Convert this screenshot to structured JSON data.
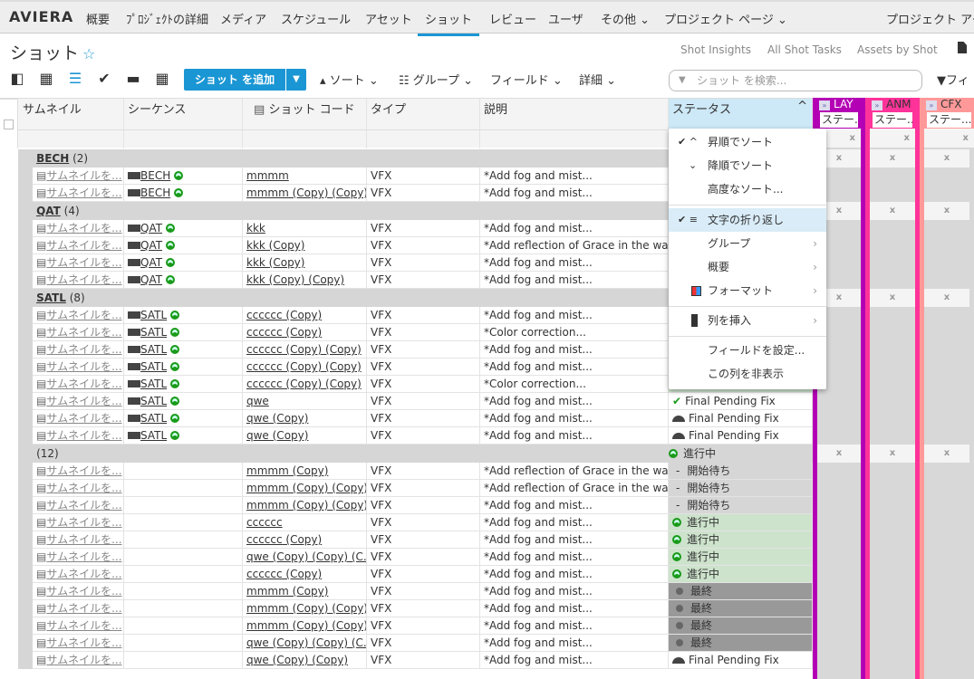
{
  "nav": {
    "logo": "AVIERA",
    "items": [
      "概要",
      "ﾌﾟﾛｼﾞｪｸﾄの詳細",
      "メディア",
      "スケジュール",
      "アセット",
      "ショット",
      "レビュー",
      "ユーザ",
      "その他 ⌄",
      "プロジェクト ページ ⌄"
    ],
    "active": "ショット",
    "right": "プロジェクト アク"
  },
  "page": {
    "title": "ショット",
    "links": [
      "Shot Insights",
      "All Shot Tasks",
      "Assets by Shot"
    ]
  },
  "toolbar": {
    "add": "ショット を追加",
    "sort": "ソート",
    "group": "グループ",
    "fields": "フィールド",
    "detail": "詳細",
    "search_placeholder": "ショット を検索...",
    "filter": "フィ"
  },
  "columns": [
    "サムネイル",
    "シーケンス",
    "ショット コード",
    "タイプ",
    "説明",
    "ステータス"
  ],
  "tasks": [
    {
      "name": "LAY",
      "color": "#b400b4",
      "text": "#fff"
    },
    {
      "name": "ANM",
      "color": "#ff3399",
      "text": "#333"
    },
    {
      "name": "CFX",
      "color": "#ff9999",
      "text": "#333"
    }
  ],
  "task_sub": "ステー...",
  "thumb_text": "サムネイルを...",
  "groups": [
    {
      "name": "BECH",
      "count": "(2)",
      "rows": [
        {
          "seq": "BECH",
          "code": "mmmm",
          "type": "VFX",
          "desc": "*Add fog and mist...",
          "status": ""
        },
        {
          "seq": "BECH",
          "code": "mmmm (Copy) (Copy)",
          "type": "VFX",
          "desc": "*Add fog and mist...",
          "status": ""
        }
      ]
    },
    {
      "name": "QAT",
      "count": "(4)",
      "rows": [
        {
          "seq": "QAT",
          "code": "kkk",
          "type": "VFX",
          "desc": "*Add fog and mist...",
          "status": ""
        },
        {
          "seq": "QAT",
          "code": "kkk (Copy)",
          "type": "VFX",
          "desc": "*Add reflection of Grace in the wat...",
          "status": ""
        },
        {
          "seq": "QAT",
          "code": "kkk (Copy)",
          "type": "VFX",
          "desc": "*Add fog and mist...",
          "status": ""
        },
        {
          "seq": "QAT",
          "code": "kkk (Copy) (Copy)",
          "type": "VFX",
          "desc": "*Add fog and mist...",
          "status": ""
        }
      ]
    },
    {
      "name": "SATL",
      "count": "(8)",
      "rows": [
        {
          "seq": "SATL",
          "code": "cccccc (Copy)",
          "type": "VFX",
          "desc": "*Add fog and mist...",
          "status": ""
        },
        {
          "seq": "SATL",
          "code": "cccccc (Copy)",
          "type": "VFX",
          "desc": "*Color correction...",
          "status": ""
        },
        {
          "seq": "SATL",
          "code": "cccccc (Copy) (Copy)",
          "type": "VFX",
          "desc": "*Add fog and mist...",
          "status": ""
        },
        {
          "seq": "SATL",
          "code": "cccccc (Copy) (Copy)",
          "type": "VFX",
          "desc": "*Add fog and mist...",
          "status": ""
        },
        {
          "seq": "SATL",
          "code": "cccccc (Copy) (Copy)",
          "type": "VFX",
          "desc": "*Color correction...",
          "status": "ip"
        },
        {
          "seq": "SATL",
          "code": "qwe",
          "type": "VFX",
          "desc": "*Add fog and mist...",
          "status": "fpf-check"
        },
        {
          "seq": "SATL",
          "code": "qwe (Copy)",
          "type": "VFX",
          "desc": "*Add fog and mist...",
          "status": "fpf"
        },
        {
          "seq": "SATL",
          "code": "qwe (Copy)",
          "type": "VFX",
          "desc": "*Add fog and mist...",
          "status": "fpf"
        }
      ]
    },
    {
      "name": "",
      "count": "(12)",
      "status": "進行中",
      "rows": [
        {
          "seq": "",
          "code": "mmmm (Copy)",
          "type": "VFX",
          "desc": "*Add reflection of Grace in the wat...",
          "status": "wtg"
        },
        {
          "seq": "",
          "code": "mmmm (Copy) (Copy)",
          "type": "VFX",
          "desc": "*Add reflection of Grace in the wat...",
          "status": "wtg"
        },
        {
          "seq": "",
          "code": "mmmm (Copy) (Copy)",
          "type": "VFX",
          "desc": "*Add fog and mist...",
          "status": "wtg"
        },
        {
          "seq": "",
          "code": "cccccc",
          "type": "VFX",
          "desc": "*Add fog and mist...",
          "status": "ip"
        },
        {
          "seq": "",
          "code": "cccccc (Copy)",
          "type": "VFX",
          "desc": "*Add fog and mist...",
          "status": "ip"
        },
        {
          "seq": "",
          "code": "qwe (Copy) (Copy) (C...",
          "type": "VFX",
          "desc": "*Add fog and mist...",
          "status": "ip"
        },
        {
          "seq": "",
          "code": "cccccc (Copy)",
          "type": "VFX",
          "desc": "*Add fog and mist...",
          "status": "ip"
        },
        {
          "seq": "",
          "code": "mmmm (Copy)",
          "type": "VFX",
          "desc": "*Add fog and mist...",
          "status": "fin"
        },
        {
          "seq": "",
          "code": "mmmm (Copy) (Copy)",
          "type": "VFX",
          "desc": "*Add fog and mist...",
          "status": "fin"
        },
        {
          "seq": "",
          "code": "mmmm (Copy) (Copy)",
          "type": "VFX",
          "desc": "*Add fog and mist...",
          "status": "fin"
        },
        {
          "seq": "",
          "code": "qwe (Copy) (Copy) (C...",
          "type": "VFX",
          "desc": "*Add fog and mist...",
          "status": "fin"
        },
        {
          "seq": "",
          "code": "qwe (Copy) (Copy)",
          "type": "VFX",
          "desc": "*Add fog and mist...",
          "status": "fpf"
        }
      ]
    }
  ],
  "status_labels": {
    "wtg": "開始待ち",
    "ip": "進行中",
    "fin": "最終",
    "fpf": "Final Pending Fix",
    "fpf-check": "Final Pending Fix"
  },
  "status_colors": {
    "wtg": "#d6d6d6",
    "ip": "#cde3cc",
    "fin": "#999999",
    "fpf": "#ffffff",
    "fpf-check": "#ffffff"
  },
  "menu": {
    "items": [
      "昇順でソート",
      "降順でソート",
      "高度なソート...",
      "文字の折り返し",
      "グループ",
      "概要",
      "フォーマット",
      "列を挿入",
      "フィールドを設定...",
      "この列を非表示"
    ]
  }
}
